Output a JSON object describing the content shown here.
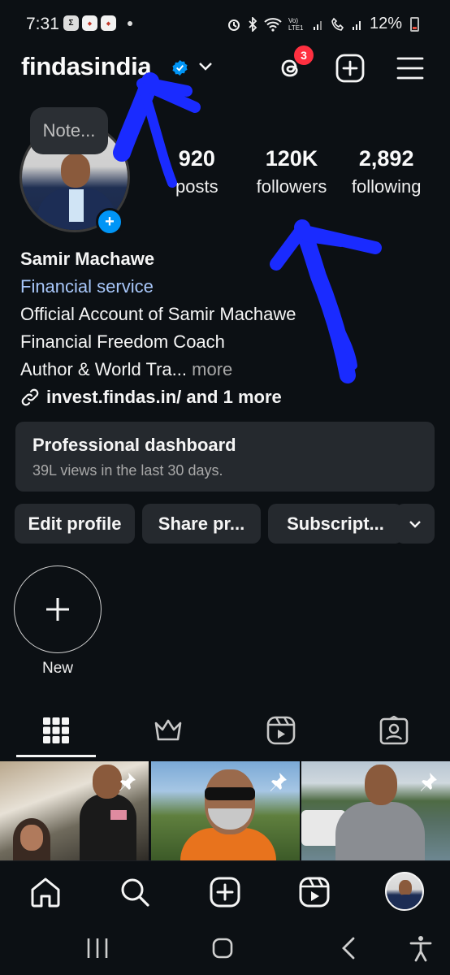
{
  "status_bar": {
    "time": "7:31",
    "battery": "12%",
    "network": "Vo) LTE1"
  },
  "header": {
    "username": "findasindia",
    "threads_badge": "3",
    "icons": [
      "verified-badge-icon",
      "chevron-down-icon",
      "threads-icon",
      "add-post-icon",
      "menu-icon"
    ]
  },
  "profile": {
    "note_placeholder": "Note...",
    "stats": [
      {
        "value": "920",
        "label": "posts"
      },
      {
        "value": "120K",
        "label": "followers"
      },
      {
        "value": "2,892",
        "label": "following"
      }
    ],
    "name": "Samir Machawe",
    "category": "Financial service",
    "bio_lines": [
      "Official Account of Samir Machawe",
      "Financial Freedom Coach"
    ],
    "bio_truncated": "Author & World Tra...",
    "more_label": "more",
    "link": "invest.findas.in/ and 1 more"
  },
  "dashboard": {
    "title": "Professional dashboard",
    "subtitle": "39L views in the last 30 days."
  },
  "actions": {
    "edit": "Edit profile",
    "share": "Share pr...",
    "subscribe": "Subscript..."
  },
  "highlights": {
    "new_label": "New"
  },
  "tabs": [
    "grid-icon",
    "crown-icon",
    "reels-icon",
    "tagged-icon"
  ],
  "colors": {
    "background": "#0c1014",
    "surface": "#25292e",
    "accent": "#0095f6",
    "link": "#a8c7fa",
    "badge": "#ff3040",
    "annotation": "#1a2bff"
  }
}
